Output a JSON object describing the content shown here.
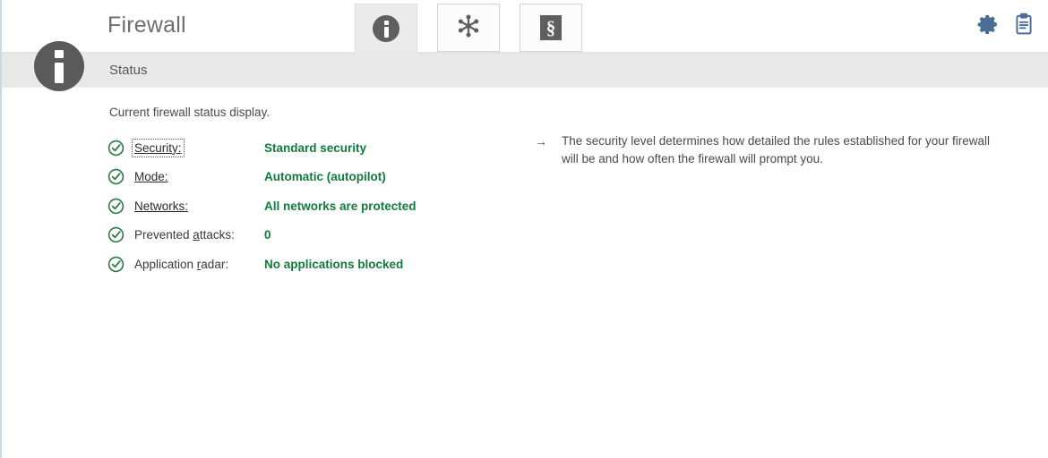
{
  "window": {
    "title": "Firewall"
  },
  "tabs": [
    {
      "name": "tab-status",
      "icon": "info-circle-icon",
      "active": true
    },
    {
      "name": "tab-networks",
      "icon": "network-hub-icon",
      "active": false
    },
    {
      "name": "tab-rules",
      "icon": "section-sign-icon",
      "active": false
    }
  ],
  "header_tools": [
    {
      "name": "settings-gear-icon",
      "label": "Settings"
    },
    {
      "name": "report-clipboard-icon",
      "label": "Reports"
    }
  ],
  "statusbar": {
    "badge_icon": "info-icon",
    "label": "Status"
  },
  "content": {
    "intro": "Current firewall status display.",
    "rows": [
      {
        "icon": "check-circle-icon",
        "label_pre": "",
        "label_accel": "S",
        "label_post": "ecurity:",
        "is_link": true,
        "focused": true,
        "value": "Standard security"
      },
      {
        "icon": "check-circle-icon",
        "label_pre": "",
        "label_accel": "M",
        "label_post": "ode:",
        "is_link": true,
        "focused": false,
        "value": "Automatic (autopilot)"
      },
      {
        "icon": "check-circle-icon",
        "label_pre": "",
        "label_accel": "N",
        "label_post": "etworks:",
        "is_link": true,
        "focused": false,
        "value": "All networks are protected"
      },
      {
        "icon": "check-circle-icon",
        "label_pre": "Prevented ",
        "label_accel": "a",
        "label_post": "ttacks:",
        "is_link": false,
        "focused": false,
        "value": "0"
      },
      {
        "icon": "check-circle-icon",
        "label_pre": "Application ",
        "label_accel": "r",
        "label_post": "adar:",
        "is_link": false,
        "focused": false,
        "value": "No applications blocked"
      }
    ],
    "hint": {
      "bullet": "→",
      "text": "The security level determines how detailed the rules established for your firewall will be and how often the firewall will prompt you."
    }
  },
  "colors": {
    "accent_green": "#117a3d",
    "tool_blue": "#4a6d96",
    "statusbar_bg": "#e9e9e9",
    "title_gray": "#6e6e6e"
  }
}
